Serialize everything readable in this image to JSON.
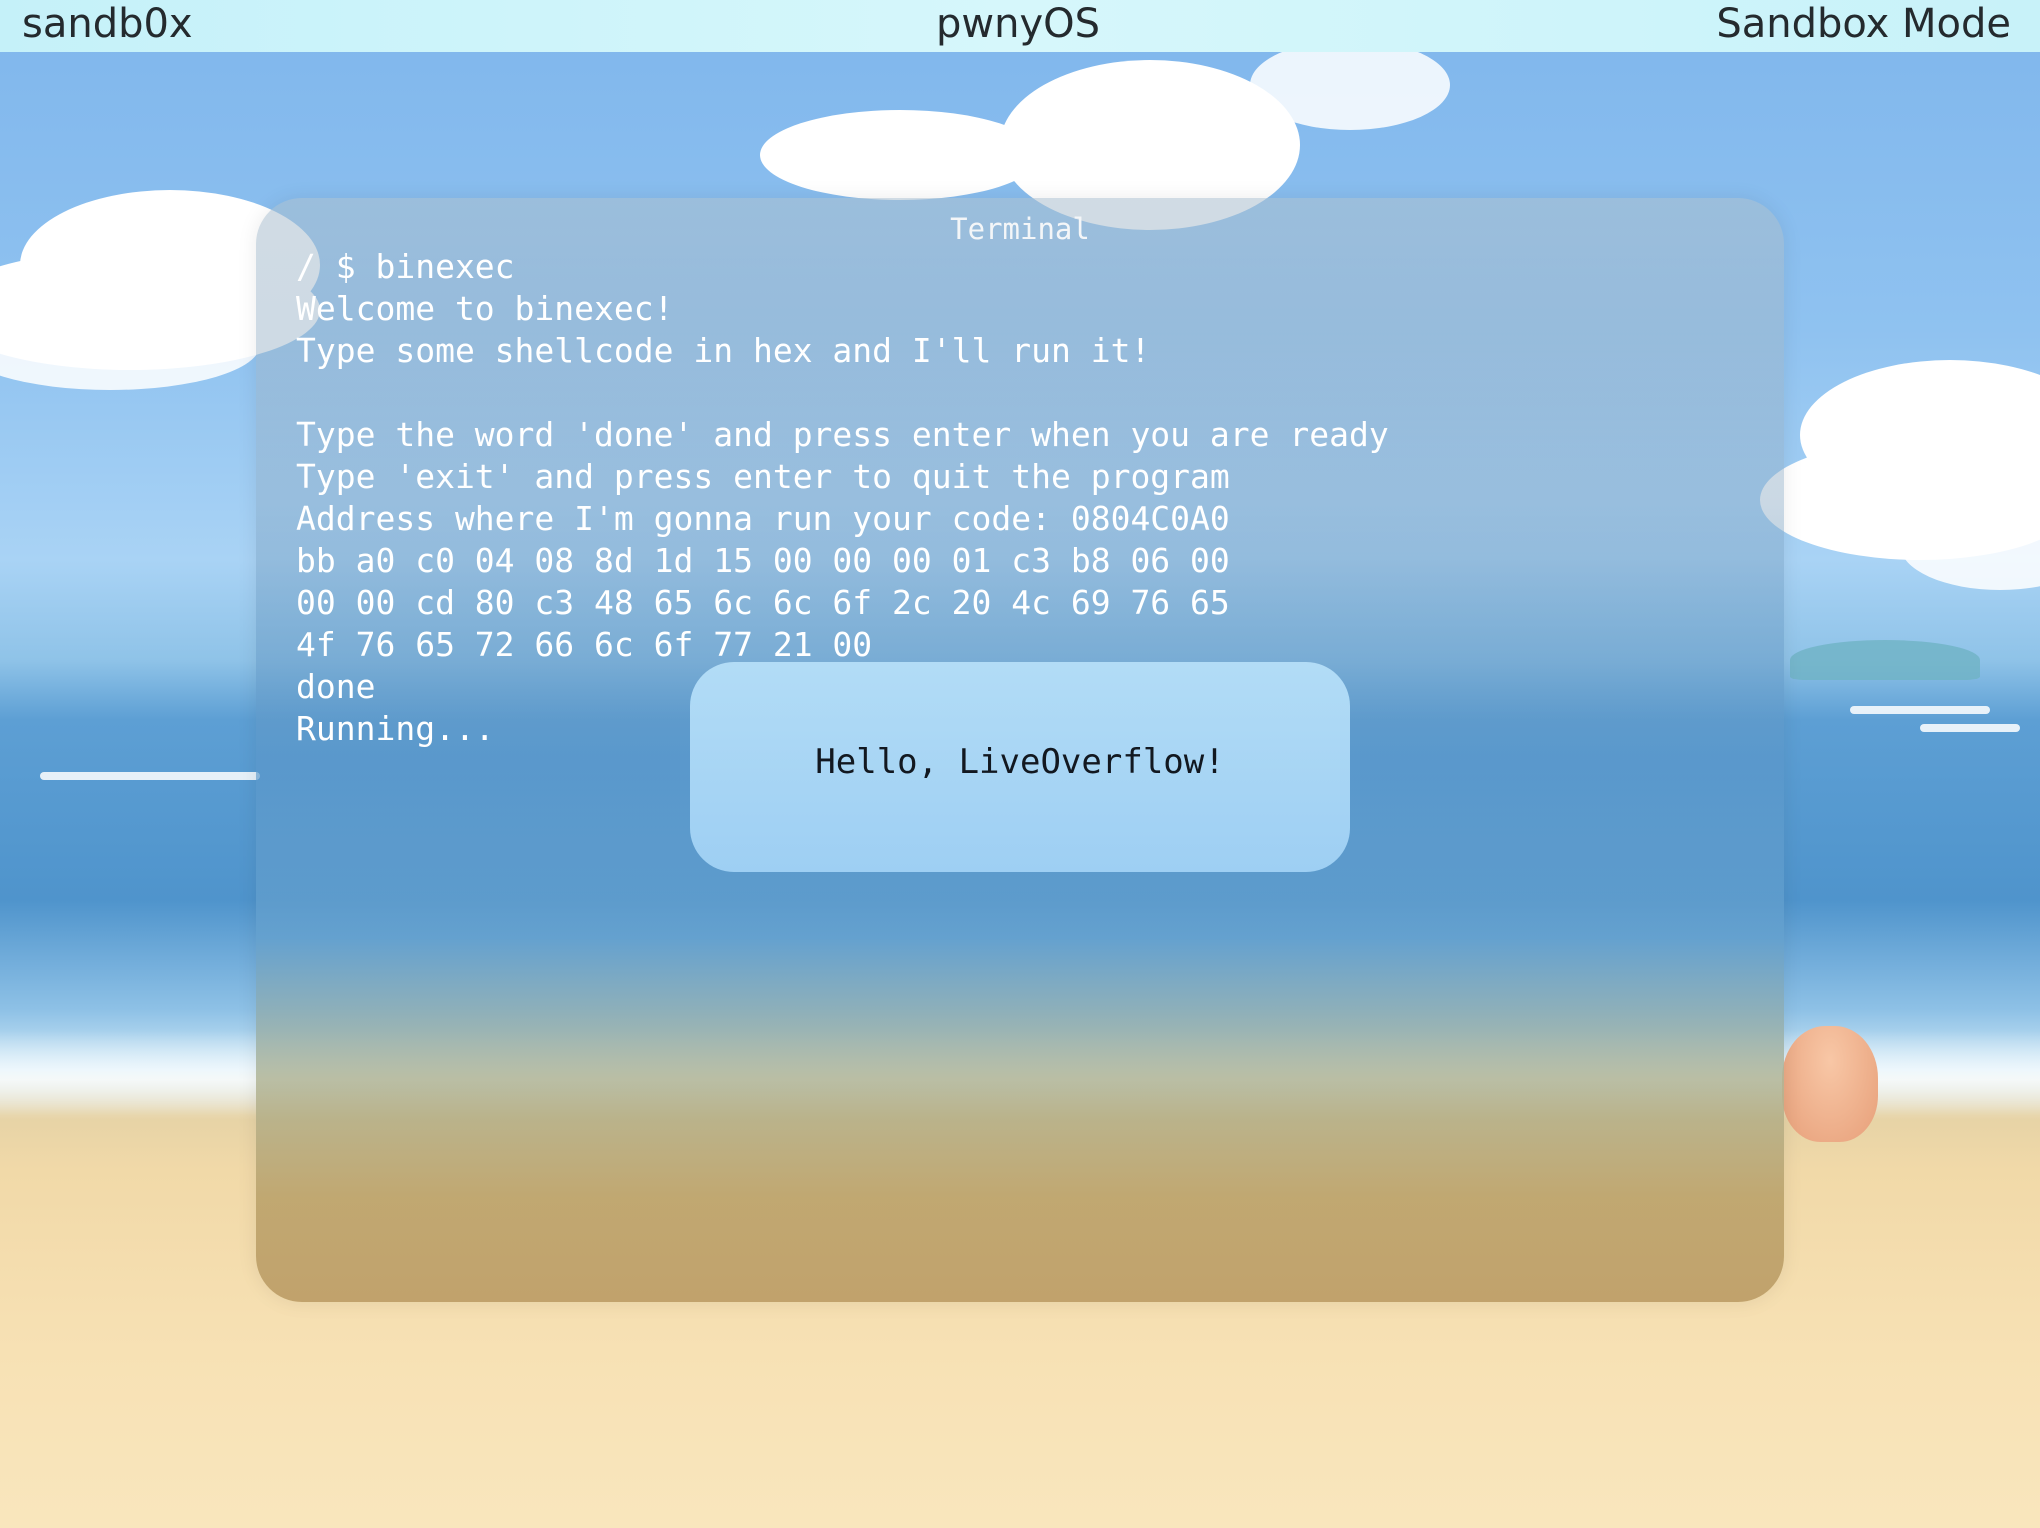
{
  "menubar": {
    "left_label": "sandb0x",
    "center_label": "pwnyOS",
    "right_label": "Sandbox Mode"
  },
  "terminal": {
    "title": "Terminal",
    "lines": [
      "/ $ binexec",
      "Welcome to binexec!",
      "Type some shellcode in hex and I'll run it!",
      "",
      "Type the word 'done' and press enter when you are ready",
      "Type 'exit' and press enter to quit the program",
      "Address where I'm gonna run your code: 0804C0A0",
      "bb a0 c0 04 08 8d 1d 15 00 00 00 01 c3 b8 06 00",
      "00 00 cd 80 c3 48 65 6c 6c 6f 2c 20 4c 69 76 65",
      "4f 76 65 72 66 6c 6f 77 21 00",
      "done",
      "Running..."
    ]
  },
  "popup": {
    "message": "Hello, LiveOverflow!"
  },
  "colors": {
    "menubar": "#c5f1f9",
    "terminal_text": "#ffffff",
    "popup": "#a8d6f4"
  }
}
